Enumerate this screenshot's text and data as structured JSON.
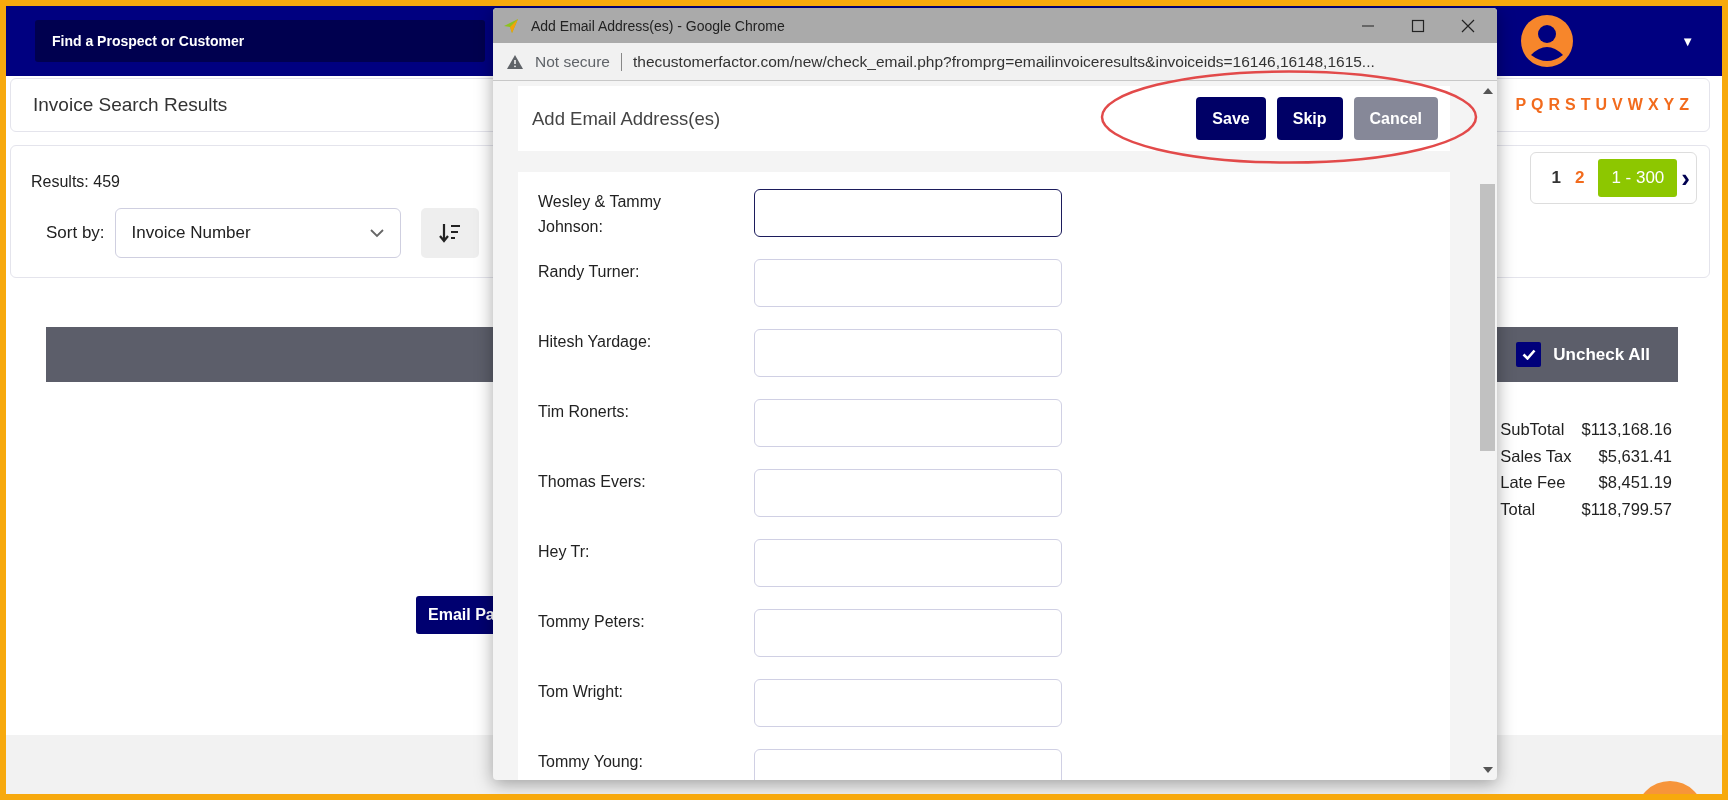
{
  "nav": {
    "search_button": "Find a Prospect or Customer",
    "user_caret": "▼"
  },
  "header_card": {
    "title": "Invoice Search Results",
    "letters": [
      "P",
      "Q",
      "R",
      "S",
      "T",
      "U",
      "V",
      "W",
      "X",
      "Y",
      "Z"
    ]
  },
  "results": {
    "count": "Results: 459",
    "sort_label": "Sort by:",
    "sort_value": "Invoice Number",
    "pages": [
      {
        "label": "1",
        "kind": "current",
        "selected": false
      },
      {
        "label": "2",
        "kind": "link",
        "selected": false
      },
      {
        "label": "1 - 300",
        "kind": "range",
        "selected": true
      }
    ],
    "next": "›"
  },
  "toolbar": {
    "uncheck_label": "Uncheck All",
    "checked": true
  },
  "totals": [
    {
      "label": "SubTotal",
      "value": "$113,168.16"
    },
    {
      "label": "Sales Tax",
      "value": "$5,631.41"
    },
    {
      "label": "Late Fee",
      "value": "$8,451.19"
    },
    {
      "label": "Total",
      "value": "$118,799.57"
    }
  ],
  "email_button": "Email Pa",
  "popup": {
    "title": "Add Email Address(es) - Google Chrome",
    "security": "Not secure",
    "url": "thecustomerfactor.com/new/check_email.php?fromprg=emailinvoiceresults&invoiceids=16146,16148,1615...",
    "heading": "Add Email Address(es)",
    "buttons": [
      {
        "label": "Save",
        "kind": "primary"
      },
      {
        "label": "Skip",
        "kind": "primary"
      },
      {
        "label": "Cancel",
        "kind": "secondary"
      }
    ],
    "fields": [
      {
        "label": "Wesley & Tammy Johnson:",
        "focused": true
      },
      {
        "label": "Randy Turner:",
        "focused": false
      },
      {
        "label": "Hitesh Yardage:",
        "focused": false
      },
      {
        "label": "Tim Ronerts:",
        "focused": false
      },
      {
        "label": "Thomas Evers:",
        "focused": false
      },
      {
        "label": "Hey Tr:",
        "focused": false
      },
      {
        "label": "Tommy Peters:",
        "focused": false
      },
      {
        "label": "Tom Wright:",
        "focused": false
      },
      {
        "label": "Tommy Young:",
        "focused": false
      }
    ]
  }
}
